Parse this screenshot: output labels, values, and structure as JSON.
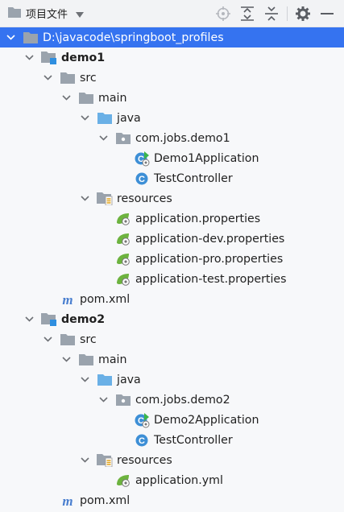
{
  "toolbar": {
    "title": "项目文件"
  },
  "tree": [
    {
      "label": "D:\\javacode\\springboot_profiles",
      "depth": 0,
      "expanded": true,
      "icon": "folder-icon",
      "selected": true,
      "bold": false
    },
    {
      "label": "demo1",
      "depth": 1,
      "expanded": true,
      "icon": "module-folder-icon",
      "bold": true
    },
    {
      "label": "src",
      "depth": 2,
      "expanded": true,
      "icon": "folder-icon"
    },
    {
      "label": "main",
      "depth": 3,
      "expanded": true,
      "icon": "folder-icon"
    },
    {
      "label": "java",
      "depth": 4,
      "expanded": true,
      "icon": "source-folder-icon"
    },
    {
      "label": "com.jobs.demo1",
      "depth": 5,
      "expanded": true,
      "icon": "package-icon"
    },
    {
      "label": "Demo1Application",
      "depth": 6,
      "icon": "spring-boot-class-icon"
    },
    {
      "label": "TestController",
      "depth": 6,
      "icon": "class-icon"
    },
    {
      "label": "resources",
      "depth": 4,
      "expanded": true,
      "icon": "resources-folder-icon"
    },
    {
      "label": "application.properties",
      "depth": 5,
      "icon": "spring-config-icon"
    },
    {
      "label": "application-dev.properties",
      "depth": 5,
      "icon": "spring-config-icon"
    },
    {
      "label": "application-pro.properties",
      "depth": 5,
      "icon": "spring-config-icon"
    },
    {
      "label": "application-test.properties",
      "depth": 5,
      "icon": "spring-config-icon"
    },
    {
      "label": "pom.xml",
      "depth": 2,
      "icon": "maven-icon"
    },
    {
      "label": "demo2",
      "depth": 1,
      "expanded": true,
      "icon": "module-folder-icon",
      "bold": true
    },
    {
      "label": "src",
      "depth": 2,
      "expanded": true,
      "icon": "folder-icon"
    },
    {
      "label": "main",
      "depth": 3,
      "expanded": true,
      "icon": "folder-icon"
    },
    {
      "label": "java",
      "depth": 4,
      "expanded": true,
      "icon": "source-folder-icon"
    },
    {
      "label": "com.jobs.demo2",
      "depth": 5,
      "expanded": true,
      "icon": "package-icon"
    },
    {
      "label": "Demo2Application",
      "depth": 6,
      "icon": "spring-boot-class-icon"
    },
    {
      "label": "TestController",
      "depth": 6,
      "icon": "class-icon"
    },
    {
      "label": "resources",
      "depth": 4,
      "expanded": true,
      "icon": "resources-folder-icon"
    },
    {
      "label": "application.yml",
      "depth": 5,
      "icon": "spring-config-icon"
    },
    {
      "label": "pom.xml",
      "depth": 2,
      "icon": "maven-icon"
    }
  ],
  "colors": {
    "selection": "#3573f0",
    "folder": "#9aa3ad",
    "source_folder": "#6ab0e6",
    "spring": "#6db33f",
    "class": "#3d8fd6",
    "maven": "#4a7fcf"
  }
}
